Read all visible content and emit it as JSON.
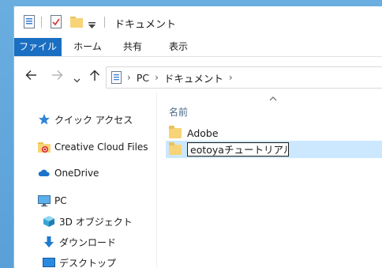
{
  "window": {
    "title": "ドキュメント"
  },
  "quick_access": {
    "icons": [
      "properties-icon",
      "checkmark-doc-icon",
      "new-folder-icon",
      "customize-dropdown-icon"
    ]
  },
  "ribbon": {
    "tabs": [
      {
        "label": "ファイル",
        "active": true
      },
      {
        "label": "ホーム"
      },
      {
        "label": "共有"
      },
      {
        "label": "表示"
      }
    ]
  },
  "address": {
    "crumbs": [
      "PC",
      "ドキュメント"
    ],
    "sep": "›"
  },
  "sidebar": {
    "items": [
      {
        "label": "クイック アクセス",
        "icon": "star-icon"
      },
      {
        "label": "Creative Cloud Files",
        "icon": "creative-cloud-folder-icon"
      },
      {
        "label": "OneDrive",
        "icon": "cloud-icon"
      },
      {
        "label": "PC",
        "icon": "computer-icon"
      },
      {
        "label": "3D オブジェクト",
        "icon": "cube-icon"
      },
      {
        "label": "ダウンロード",
        "icon": "download-arrow-icon"
      },
      {
        "label": "デスクトップ",
        "icon": "desktop-icon"
      }
    ]
  },
  "content": {
    "column_name": "名前",
    "files": [
      {
        "name": "Adobe"
      },
      {
        "name": "eotoyaチュートリアル",
        "editing": true
      }
    ]
  },
  "colors": {
    "accent": "#1a6fc2",
    "selection": "#cce8ff",
    "folder": "#f6d477"
  }
}
